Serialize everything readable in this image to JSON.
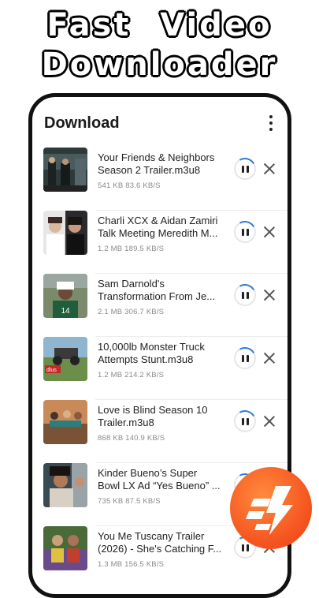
{
  "promo": {
    "line1": "Fast Video",
    "line2": "Downloader"
  },
  "header": {
    "title": "Download",
    "menu_icon": "more-vert-icon"
  },
  "downloads": [
    {
      "title1": "Your Friends & Neighbors",
      "title2": "Season 2 Trailer.m3u8",
      "size": "541 KB",
      "speed": "83.6 KB/S"
    },
    {
      "title1": "Charli XCX & Aidan Zamiri",
      "title2": "Talk Meeting Meredith M...",
      "size": "1.2 MB",
      "speed": "189.5 KB/S"
    },
    {
      "title1": "Sam Darnold's",
      "title2": "Transformation From Je...",
      "size": "2.1 MB",
      "speed": "306.7 KB/S"
    },
    {
      "title1": "10,000lb Monster Truck",
      "title2": "Attempts Stunt.m3u8",
      "size": "1.2 MB",
      "speed": "214.2 KB/S"
    },
    {
      "title1": "Love is Blind Season 10",
      "title2": "Trailer.m3u8",
      "size": "868 KB",
      "speed": "140.9 KB/S"
    },
    {
      "title1": "Kinder Bueno’s Super",
      "title2": "Bowl LX Ad “Yes Bueno” ...",
      "size": "735 KB",
      "speed": "87.5 KB/S"
    },
    {
      "title1": "You Me Tuscany Trailer",
      "title2": "(2026) - She's Catching F...",
      "size": "1.3 MB",
      "speed": "156.5 KB/S"
    }
  ],
  "fab": {
    "icon": "lightning-bolt-icon"
  },
  "colors": {
    "accent": "#2f7bd8",
    "fab": "#f4511e"
  }
}
